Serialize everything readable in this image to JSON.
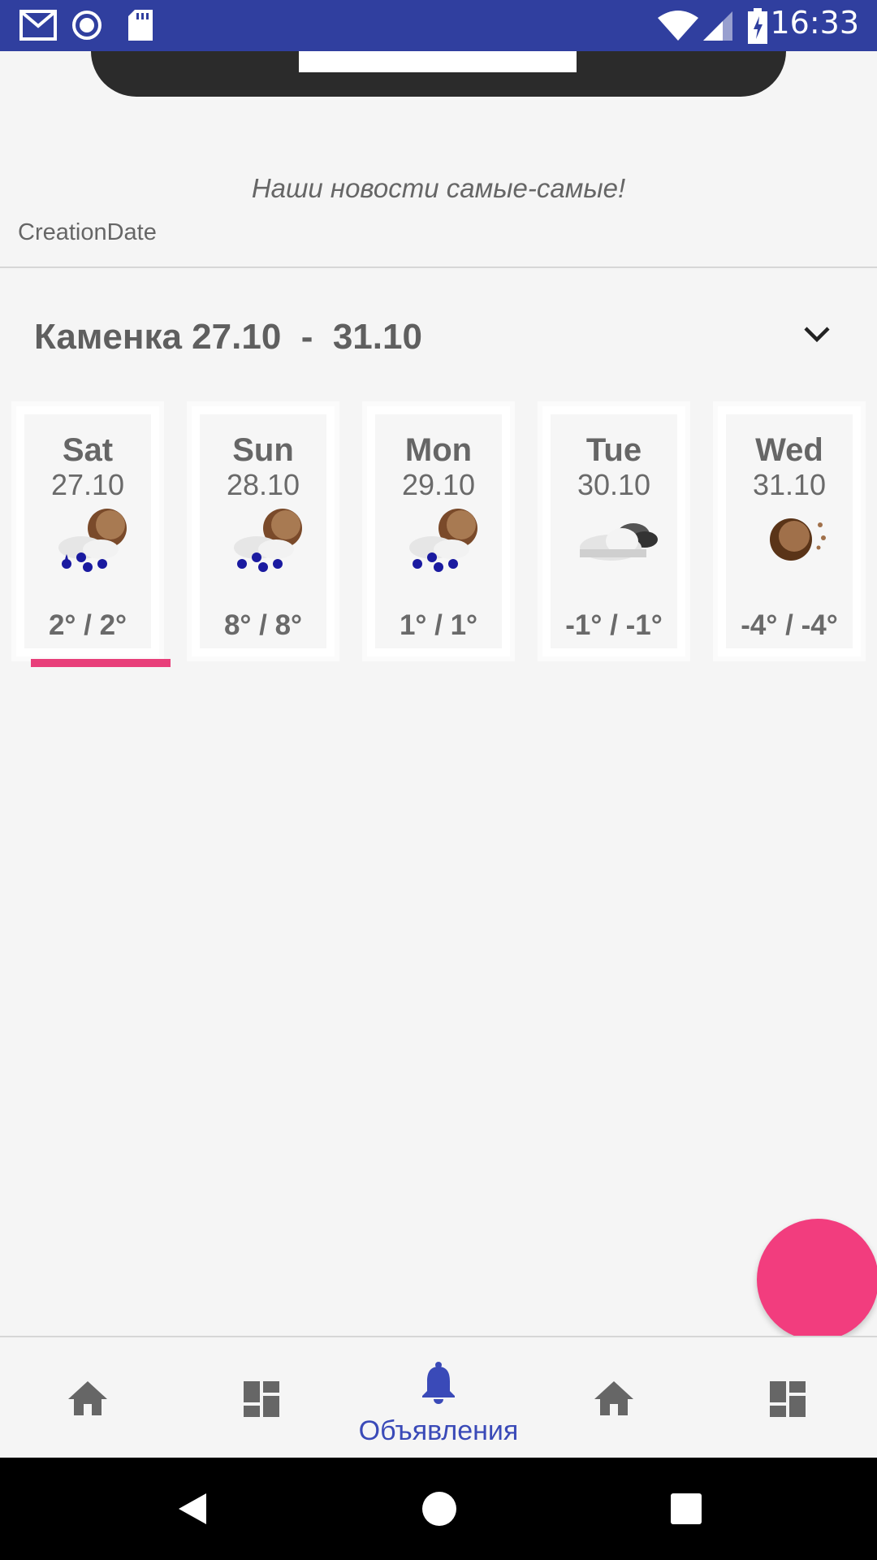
{
  "status_bar": {
    "time": "16:33",
    "icons": [
      "gmail-icon",
      "record-icon",
      "sd-card-icon",
      "wifi-icon",
      "signal-icon",
      "battery-charging-icon"
    ]
  },
  "header": {
    "slogan": "Наши новости самые-самые!",
    "creation_date_label": "CreationDate"
  },
  "weather": {
    "title": "Каменка 27.10  -  31.10",
    "expand_icon": "chevron-down-icon",
    "selected_index": 0,
    "days": [
      {
        "name": "Sat",
        "date": "27.10",
        "temp": "2° / 2°",
        "icon": "rain-sun-icon"
      },
      {
        "name": "Sun",
        "date": "28.10",
        "temp": "8° / 8°",
        "icon": "rain-sun-icon"
      },
      {
        "name": "Mon",
        "date": "29.10",
        "temp": "1° / 1°",
        "icon": "rain-sun-icon"
      },
      {
        "name": "Tue",
        "date": "30.10",
        "temp": "-1° / -1°",
        "icon": "cloudy-icon"
      },
      {
        "name": "Wed",
        "date": "31.10",
        "temp": "-4° / -4°",
        "icon": "sun-icon"
      }
    ]
  },
  "bottom_nav": {
    "items": [
      {
        "icon": "home-icon",
        "label": ""
      },
      {
        "icon": "dashboard-icon",
        "label": ""
      },
      {
        "icon": "bell-icon",
        "label": "Объявления"
      },
      {
        "icon": "home-icon",
        "label": ""
      },
      {
        "icon": "dashboard-icon",
        "label": ""
      }
    ],
    "active_index": 2
  },
  "colors": {
    "status_bar": "#303f9f",
    "accent": "#f23d7e",
    "nav_active": "#3a4ab8"
  }
}
